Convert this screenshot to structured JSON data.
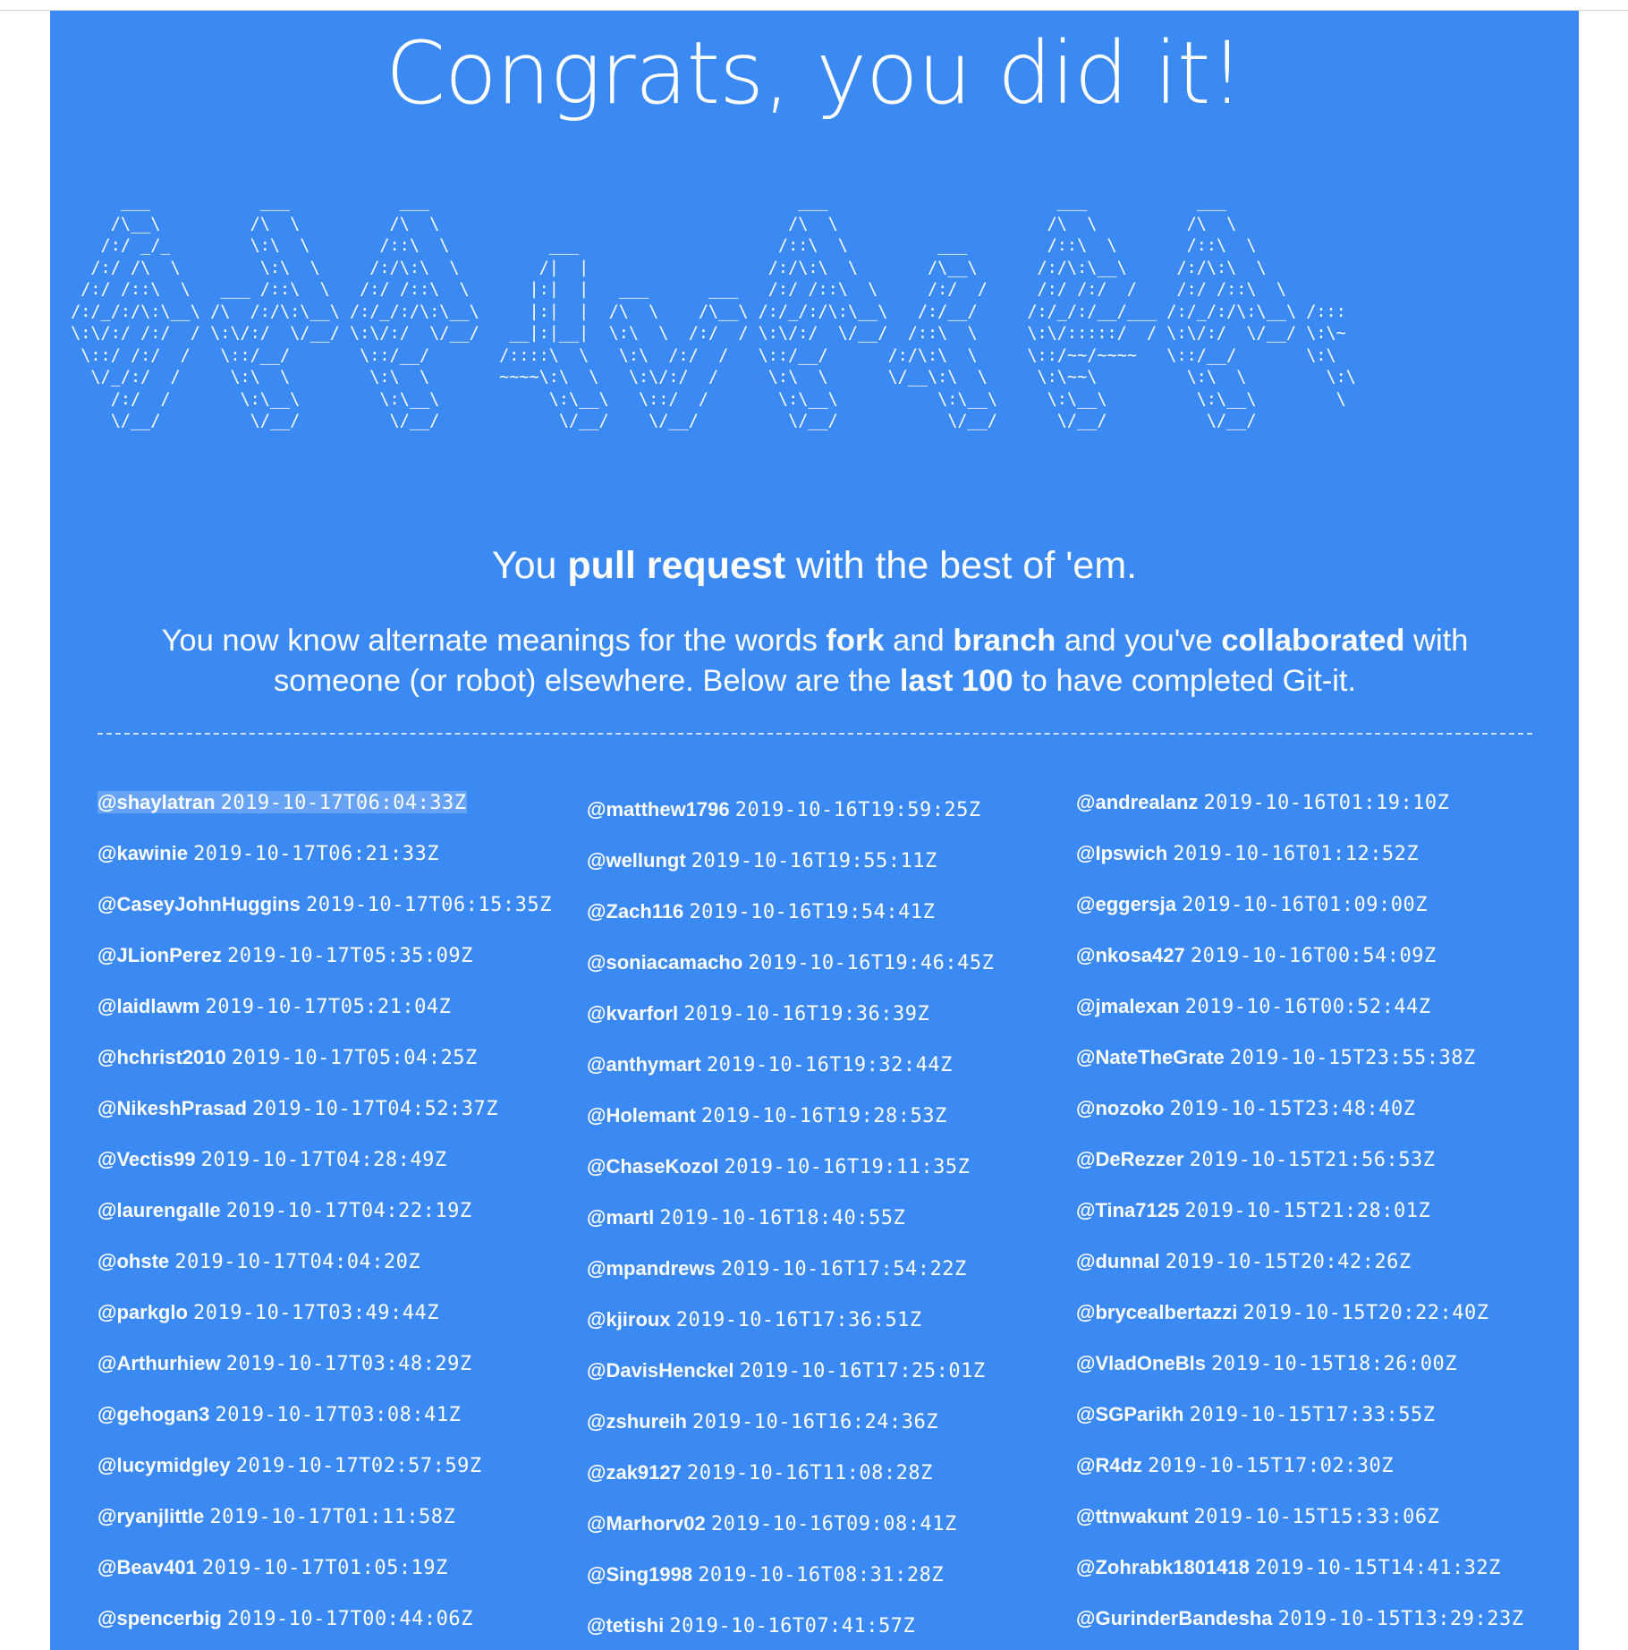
{
  "heading": "Congrats, you did it!",
  "ascii_art": "      ___           ___           ___                                     ___                       ___           ___       \n     /\\__\\         /\\  \\         /\\  \\                                   /\\  \\                     /\\  \\         /\\  \\      \n    /:/ _/_        \\:\\  \\       /::\\  \\          ___                    /::\\  \\         ___        /::\\  \\       /::\\  \\     \n   /:/ /\\  \\        \\:\\  \\     /:/\\:\\  \\        /|  |                  /:/\\:\\  \\       /\\__\\      /:/\\:\\__\\     /:/\\:\\  \\    \n  /:/ /::\\  \\   ___ /::\\  \\   /:/ /::\\  \\      |:|  |   ___      ___   /:/ /::\\  \\     /:/  /     /:/ /:/  /    /:/ /::\\  \\   \n /:/_/:/\\:\\__\\ /\\  /:/\\:\\__\\ /:/_/:/\\:\\__\\     |:|  |  /\\  \\    /\\__\\ /:/_/:/\\:\\__\\   /:/__/     /:/_/:/__/___ /:/_/:/\\:\\__\\ /:::\n \\:\\/:/ /:/  / \\:\\/:/  \\/__/ \\:\\/:/  \\/__/   __|:|__|  \\:\\  \\  /:/  / \\:\\/:/  \\/__/  /::\\  \\     \\:\\/:::::/  / \\:\\/:/  \\/__/ \\:\\~\n  \\::/ /:/  /   \\::/__/       \\::/__/       /::::\\  \\   \\:\\  /:/  /   \\::/__/      /:/\\:\\  \\     \\::/~~/~~~~   \\::/__/       \\:\\\n   \\/_/:/  /     \\:\\  \\        \\:\\  \\       ~~~~\\:\\  \\   \\:\\/:/  /     \\:\\  \\      \\/__\\:\\  \\     \\:\\~~\\         \\:\\  \\        \\:\\\n     /:/  /       \\:\\__\\        \\:\\__\\           \\:\\__\\   \\::/  /       \\:\\__\\          \\:\\__\\     \\:\\__\\         \\:\\__\\        \\\n     \\/__/         \\/__/         \\/__/            \\/__/    \\/__/         \\/__/           \\/__/      \\/__/          \\/__/         ",
  "tagline": {
    "pre": "You ",
    "bold": "pull request",
    "post": " with the best of 'em."
  },
  "intro": {
    "t1": "You now know alternate meanings for the words ",
    "b1": "fork",
    "t2": " and ",
    "b2": "branch",
    "t3": " and you've ",
    "b3": "collaborated",
    "t4": " with someone (or robot) elsewhere. Below are the ",
    "b4": "last 100",
    "t5": " to have completed Git-it."
  },
  "completions": {
    "col1": [
      {
        "user": "@shaylatran",
        "ts": "2019-10-17T06:04:33Z"
      },
      {
        "user": "@kawinie",
        "ts": "2019-10-17T06:21:33Z"
      },
      {
        "user": "@CaseyJohnHuggins",
        "ts": "2019-10-17T06:15:35Z"
      },
      {
        "user": "@JLionPerez",
        "ts": "2019-10-17T05:35:09Z"
      },
      {
        "user": "@laidlawm",
        "ts": "2019-10-17T05:21:04Z"
      },
      {
        "user": "@hchrist2010",
        "ts": "2019-10-17T05:04:25Z"
      },
      {
        "user": "@NikeshPrasad",
        "ts": "2019-10-17T04:52:37Z"
      },
      {
        "user": "@Vectis99",
        "ts": "2019-10-17T04:28:49Z"
      },
      {
        "user": "@laurengalle",
        "ts": "2019-10-17T04:22:19Z"
      },
      {
        "user": "@ohste",
        "ts": "2019-10-17T04:04:20Z"
      },
      {
        "user": "@parkglo",
        "ts": "2019-10-17T03:49:44Z"
      },
      {
        "user": "@Arthurhiew",
        "ts": "2019-10-17T03:48:29Z"
      },
      {
        "user": "@gehogan3",
        "ts": "2019-10-17T03:08:41Z"
      },
      {
        "user": "@lucymidgley",
        "ts": "2019-10-17T02:57:59Z"
      },
      {
        "user": "@ryanjlittle",
        "ts": "2019-10-17T01:11:58Z"
      },
      {
        "user": "@Beav401",
        "ts": "2019-10-17T01:05:19Z"
      },
      {
        "user": "@spencerbig",
        "ts": "2019-10-17T00:44:06Z"
      }
    ],
    "col2": [
      {
        "user": "@matthew1796",
        "ts": "2019-10-16T19:59:25Z"
      },
      {
        "user": "@wellungt",
        "ts": "2019-10-16T19:55:11Z"
      },
      {
        "user": "@Zach116",
        "ts": "2019-10-16T19:54:41Z"
      },
      {
        "user": "@soniacamacho",
        "ts": "2019-10-16T19:46:45Z"
      },
      {
        "user": "@kvarforl",
        "ts": "2019-10-16T19:36:39Z"
      },
      {
        "user": "@anthymart",
        "ts": "2019-10-16T19:32:44Z"
      },
      {
        "user": "@Holemant",
        "ts": "2019-10-16T19:28:53Z"
      },
      {
        "user": "@ChaseKozol",
        "ts": "2019-10-16T19:11:35Z"
      },
      {
        "user": "@martl",
        "ts": "2019-10-16T18:40:55Z"
      },
      {
        "user": "@mpandrews",
        "ts": "2019-10-16T17:54:22Z"
      },
      {
        "user": "@kjiroux",
        "ts": "2019-10-16T17:36:51Z"
      },
      {
        "user": "@DavisHenckel",
        "ts": "2019-10-16T17:25:01Z"
      },
      {
        "user": "@zshureih",
        "ts": "2019-10-16T16:24:36Z"
      },
      {
        "user": "@zak9127",
        "ts": "2019-10-16T11:08:28Z"
      },
      {
        "user": "@Marhorv02",
        "ts": "2019-10-16T09:08:41Z"
      },
      {
        "user": "@Sing1998",
        "ts": "2019-10-16T08:31:28Z"
      },
      {
        "user": "@tetishi",
        "ts": "2019-10-16T07:41:57Z"
      }
    ],
    "col3": [
      {
        "user": "@andrealanz",
        "ts": "2019-10-16T01:19:10Z"
      },
      {
        "user": "@Ipswich",
        "ts": "2019-10-16T01:12:52Z"
      },
      {
        "user": "@eggersja",
        "ts": "2019-10-16T01:09:00Z"
      },
      {
        "user": "@nkosa427",
        "ts": "2019-10-16T00:54:09Z"
      },
      {
        "user": "@jmalexan",
        "ts": "2019-10-16T00:52:44Z"
      },
      {
        "user": "@NateTheGrate",
        "ts": "2019-10-15T23:55:38Z"
      },
      {
        "user": "@nozoko",
        "ts": "2019-10-15T23:48:40Z"
      },
      {
        "user": "@DeRezzer",
        "ts": "2019-10-15T21:56:53Z"
      },
      {
        "user": "@Tina7125",
        "ts": "2019-10-15T21:28:01Z"
      },
      {
        "user": "@dunnal",
        "ts": "2019-10-15T20:42:26Z"
      },
      {
        "user": "@brycealbertazzi",
        "ts": "2019-10-15T20:22:40Z"
      },
      {
        "user": "@VladOneBls",
        "ts": "2019-10-15T18:26:00Z"
      },
      {
        "user": "@SGParikh",
        "ts": "2019-10-15T17:33:55Z"
      },
      {
        "user": "@R4dz",
        "ts": "2019-10-15T17:02:30Z"
      },
      {
        "user": "@ttnwakunt",
        "ts": "2019-10-15T15:33:06Z"
      },
      {
        "user": "@Zohrabk1801418",
        "ts": "2019-10-15T14:41:32Z"
      },
      {
        "user": "@GurinderBandesha",
        "ts": "2019-10-15T13:29:23Z"
      }
    ]
  },
  "colors": {
    "background": "#3b89f2",
    "text": "#ffffff",
    "selection": "rgba(255,255,255,0.22)"
  }
}
